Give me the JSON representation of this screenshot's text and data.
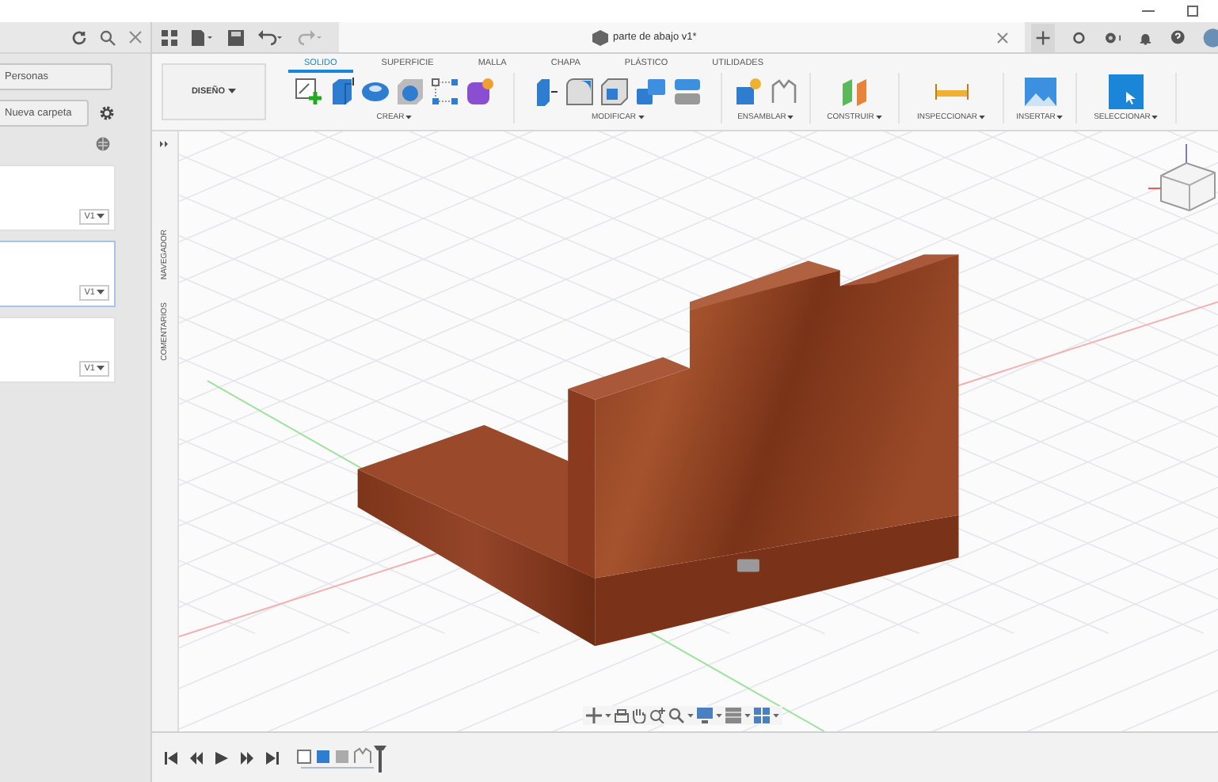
{
  "left_panel": {
    "people_button": "Personas",
    "new_folder_button": "Nueva carpeta",
    "files": [
      {
        "version": "V1",
        "selected": false
      },
      {
        "version": "V1",
        "selected": true
      },
      {
        "version": "V1",
        "selected": false
      }
    ]
  },
  "document_tab": {
    "title": "parte de abajo v1*"
  },
  "toolbar": {
    "workspace": "DISEÑO",
    "tabs": [
      {
        "label": "SOLIDO",
        "selected": true
      },
      {
        "label": "SUPERFICIE",
        "selected": false
      },
      {
        "label": "MALLA",
        "selected": false
      },
      {
        "label": "CHAPA",
        "selected": false
      },
      {
        "label": "PLÁSTICO",
        "selected": false
      },
      {
        "label": "UTILIDADES",
        "selected": false
      }
    ],
    "groups": [
      {
        "label": "CREAR"
      },
      {
        "label": "MODIFICAR"
      },
      {
        "label": "ENSAMBLAR"
      },
      {
        "label": "CONSTRUIR"
      },
      {
        "label": "INSPECCIONAR"
      },
      {
        "label": "INSERTAR"
      },
      {
        "label": "SELECCIONAR"
      }
    ]
  },
  "side_tabs": [
    "NAVEGADOR",
    "COMENTARIOS"
  ]
}
